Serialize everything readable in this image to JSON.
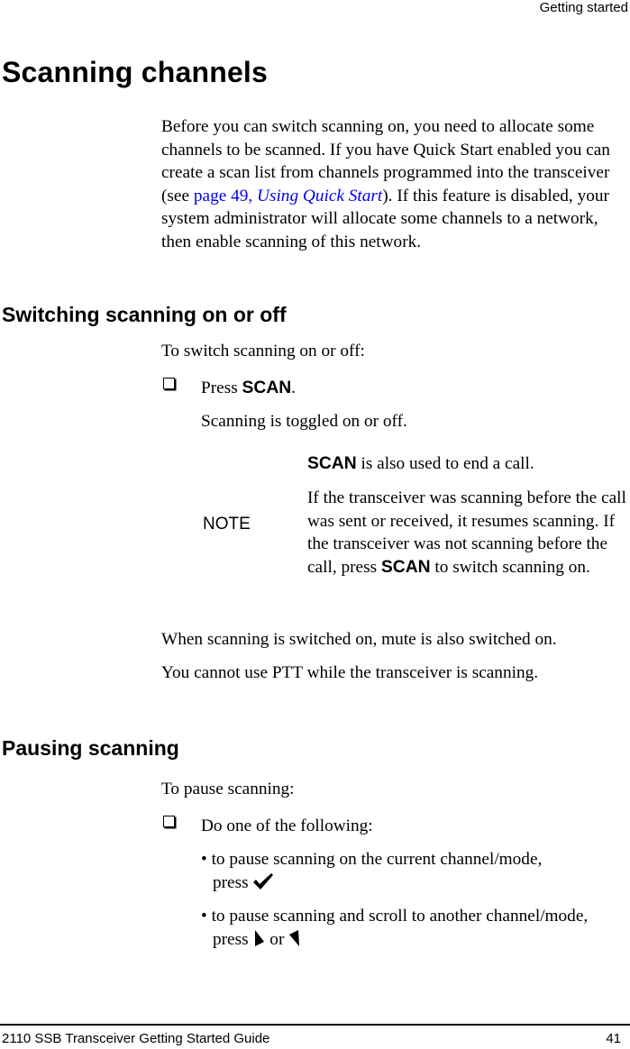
{
  "header": {
    "running_title": "Getting started"
  },
  "section_scanning_channels": {
    "title": "Scanning channels",
    "intro_part1": "Before you can switch scanning on, you need to allocate some channels to be scanned. If you have Quick Start enabled you can create a scan list from channels programmed into the transceiver (see ",
    "link_page": "page 49, ",
    "link_title": "Using Quick Start",
    "intro_part2": "). If this feature is disabled, your system administrator will allocate some channels to a network, then enable scanning of this network."
  },
  "section_switching": {
    "title": "Switching scanning on or off",
    "lead": "To switch scanning on or off:",
    "step_prefix": "Press ",
    "step_key": "SCAN",
    "step_suffix": ".",
    "result": "Scanning is toggled on or off.",
    "note": {
      "label": "NOTE",
      "line1_key": "SCAN",
      "line1_text": " is also used to end a call.",
      "line2_part1": "If the transceiver was scanning before the call was sent or received, it resumes scanning. If the transceiver was not scanning before the call, press ",
      "line2_key": "SCAN",
      "line2_part2": " to switch scanning on."
    },
    "after1": "When scanning is switched on, mute is also switched on.",
    "after2": "You cannot use PTT while the transceiver is scanning."
  },
  "section_pausing": {
    "title": "Pausing scanning",
    "lead": "To pause scanning:",
    "step": "Do one of the following:",
    "bullets": [
      {
        "text": "• to pause scanning on the current channel/mode,",
        "cont": "press",
        "icons": [
          "check-key-icon"
        ]
      },
      {
        "text": "• to pause scanning and scroll to another channel/mode,",
        "cont": "press",
        "joiner": "or",
        "icons": [
          "scroll-down-arrow-icon",
          "scroll-up-arrow-icon"
        ]
      }
    ]
  },
  "footer": {
    "doc_title": "2110 SSB Transceiver Getting Started Guide",
    "page_number": "41"
  }
}
